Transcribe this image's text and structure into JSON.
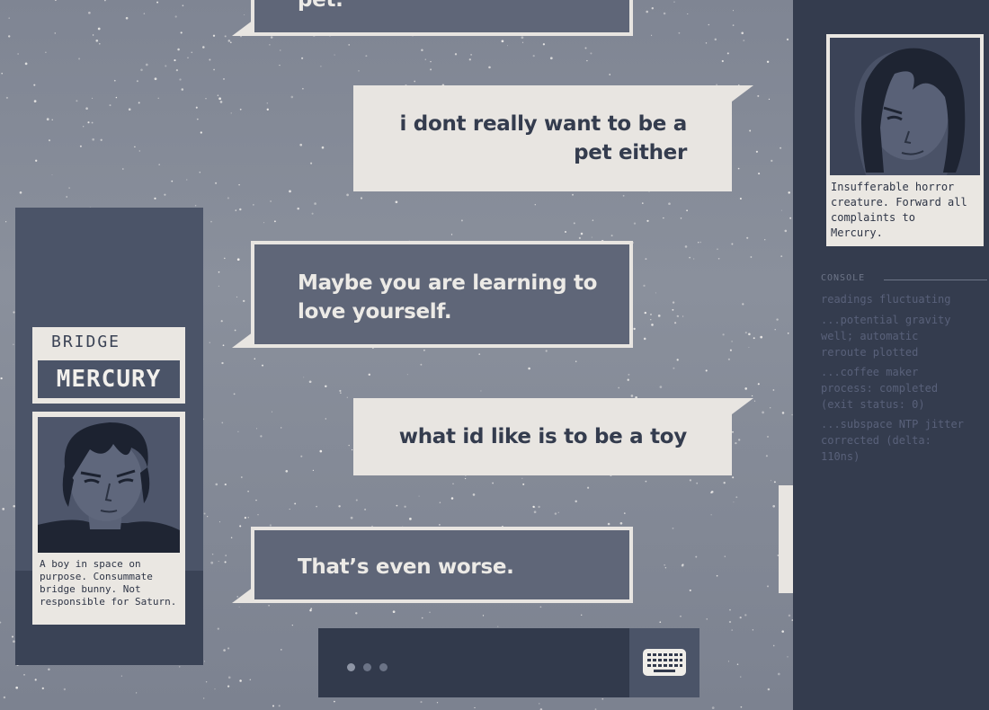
{
  "chat": {
    "messages": [
      {
        "speaker": "other",
        "text": "pet."
      },
      {
        "speaker": "self",
        "line1": "i dont really want to be a",
        "line2": "pet either"
      },
      {
        "speaker": "other",
        "line1": "Maybe you are learning to",
        "line2": "love yourself."
      },
      {
        "speaker": "self",
        "text": "what id like is to be a toy"
      },
      {
        "speaker": "other",
        "text": "That’s even worse."
      }
    ]
  },
  "left_profile": {
    "location": "BRIDGE",
    "name": "MERCURY",
    "bio_lines": [
      "A boy in space on",
      "purpose. Consummate",
      "bridge bunny. Not",
      "responsible for Saturn."
    ],
    "portrait_icon": "boy-portrait"
  },
  "right_profile": {
    "bio_lines": [
      "Insufferable horror",
      "creature. Forward all",
      "complaints to",
      "Mercury."
    ],
    "portrait_icon": "long-hair-portrait"
  },
  "system_log": {
    "header": "CONSOLE",
    "entries": [
      [
        "readings fluctuating"
      ],
      [
        "...potential gravity",
        "well; automatic",
        "reroute plotted"
      ],
      [
        "...coffee maker",
        "process: completed",
        "(exit status: 0)"
      ],
      [
        "...subspace NTP jitter",
        "corrected (delta:",
        " 110ns)"
      ]
    ]
  },
  "input": {
    "typing_indicator": "typing-dots",
    "keyboard_icon": "keyboard-icon"
  },
  "colors": {
    "dark_slate": "#343c4e",
    "panel_slate": "#4b5468",
    "bubble_dark": "#5f6678",
    "cream": "#e8e5e1"
  }
}
